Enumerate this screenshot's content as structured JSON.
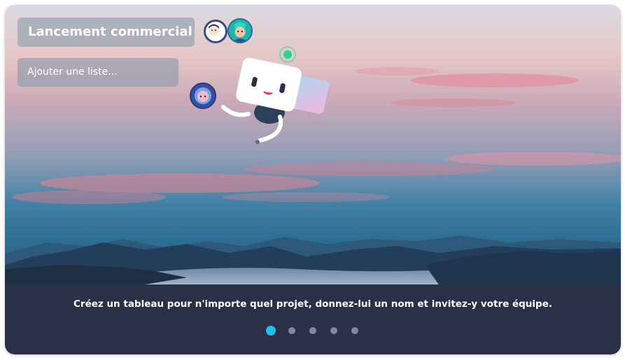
{
  "board": {
    "title": "Lancement commercial",
    "add_list_placeholder": "Ajouter une liste..."
  },
  "carousel": {
    "caption": "Créez un tableau pour n'importe quel projet, donnez-lui un nom et invitez-y votre équipe.",
    "slides_count": 5,
    "active_slide": 1
  },
  "colors": {
    "footer_bg": "#2c3047",
    "active_dot": "#1ec2e6",
    "inactive_dot": "#7a8aa0"
  },
  "icons": [
    "avatar-icon",
    "robot-mascot-icon"
  ]
}
